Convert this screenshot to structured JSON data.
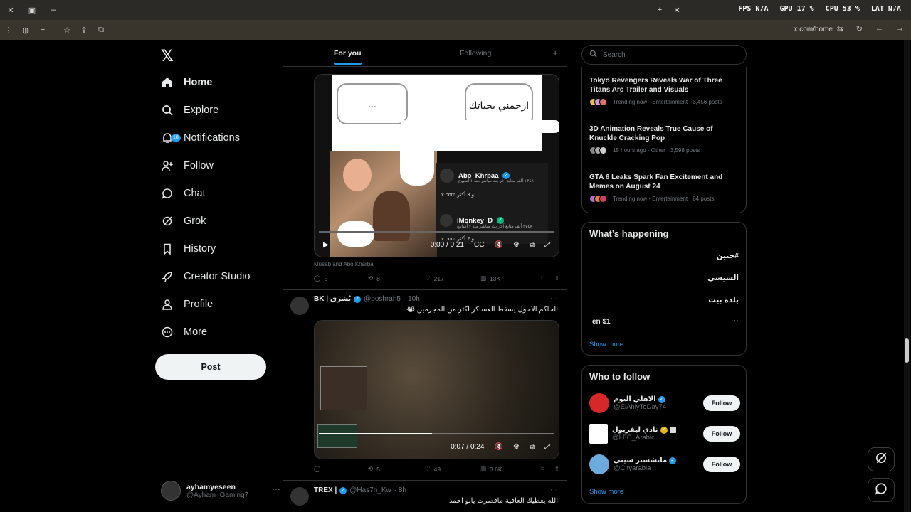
{
  "browser": {
    "url": "x.com/home",
    "stats": {
      "fps": "FPS N/A",
      "gpu": "GPU 17 %",
      "cpu": "CPU 53 %",
      "lat": "LAT N/A"
    }
  },
  "nav": {
    "items": [
      {
        "label": "Home",
        "icon": "home-icon"
      },
      {
        "label": "Explore",
        "icon": "search-icon"
      },
      {
        "label": "Notifications",
        "icon": "bell-icon",
        "badge": "18"
      },
      {
        "label": "Follow",
        "icon": "person-add-icon"
      },
      {
        "label": "Chat",
        "icon": "chat-icon"
      },
      {
        "label": "Grok",
        "icon": "grok-icon"
      },
      {
        "label": "History",
        "icon": "bookmark-icon"
      },
      {
        "label": "Creator Studio",
        "icon": "rocket-icon"
      },
      {
        "label": "Profile",
        "icon": "person-icon"
      },
      {
        "label": "More",
        "icon": "more-circle-icon"
      }
    ],
    "post_label": "Post",
    "account": {
      "name": "ayhamyeseen",
      "handle": "@Ayham_Gaming7"
    }
  },
  "tabs": {
    "for_you": "For you",
    "following": "Following"
  },
  "tweet1": {
    "bubble_right": "ارحمني بحياتك",
    "bubble_left": "...",
    "card_user1": "Abo_Khrbaa",
    "card_user1_meta": "١٣٤٨ ألف متابع آخر بث مباشر منذ ١ أسبوع",
    "card_link1": "x.com و 3 أكثر",
    "card_user2": "iMonkey_D",
    "card_user2_meta": "٣٧٤٨ ألف متابع آخر بث مباشر منذ ٢ أسابيع",
    "card_link2": "x.com و 2 أكثر",
    "video_time": "0:00 / 0:21",
    "caption": "Musab and Abo Kharba",
    "replies": "5",
    "reposts": "8",
    "likes": "217",
    "views": "13K"
  },
  "tweet2": {
    "name": "BK | بُشرى",
    "handle": "@boshrah5",
    "time": "· 10h",
    "text": "الحاكم الاحول يسقط العساكر اكثر من المجرمين 😭",
    "video_time": "0:07 / 0:24",
    "replies": "",
    "reposts": "5",
    "likes": "49",
    "views": "3.6K"
  },
  "tweet3": {
    "name": "TREX |",
    "handle": "@Has7n_Kw",
    "time": "· 8h",
    "text": "الله يعطيك العافية ماقصرت يابو احمد"
  },
  "sidebar": {
    "search_placeholder": "Search",
    "trends": [
      {
        "title": "Tokyo Revengers Reveals War of Three Titans Arc Trailer and Visuals",
        "meta": "Trending now · Entertainment · 3,456 posts"
      },
      {
        "title": "3D Animation Reveals True Cause of Knuckle Cracking Pop",
        "meta": "15 hours ago · Other · 3,598 posts"
      },
      {
        "title": "GTA 6 Leaks Spark Fan Excitement and Memes on August 24",
        "meta": "Trending now · Entertainment · 84 posts"
      }
    ],
    "happening_title": "What’s happening",
    "happening": [
      "#جنين",
      "السيسي",
      "بلده بيت",
      "en $1"
    ],
    "show_more": "Show more",
    "wtf_title": "Who to follow",
    "wtf": [
      {
        "name": "الاهلي اليوم",
        "handle": "@ElAhlyToDay74",
        "follow": "Follow",
        "color": "#d62828"
      },
      {
        "name": "نادي ليفربول",
        "handle": "@LFC_Arabic",
        "follow": "Follow",
        "color": "#ffffff"
      },
      {
        "name": "مانشستر سيتي",
        "handle": "@Cityarabia",
        "follow": "Follow",
        "color": "#6cabdd"
      }
    ],
    "show_more2": "Show more"
  }
}
